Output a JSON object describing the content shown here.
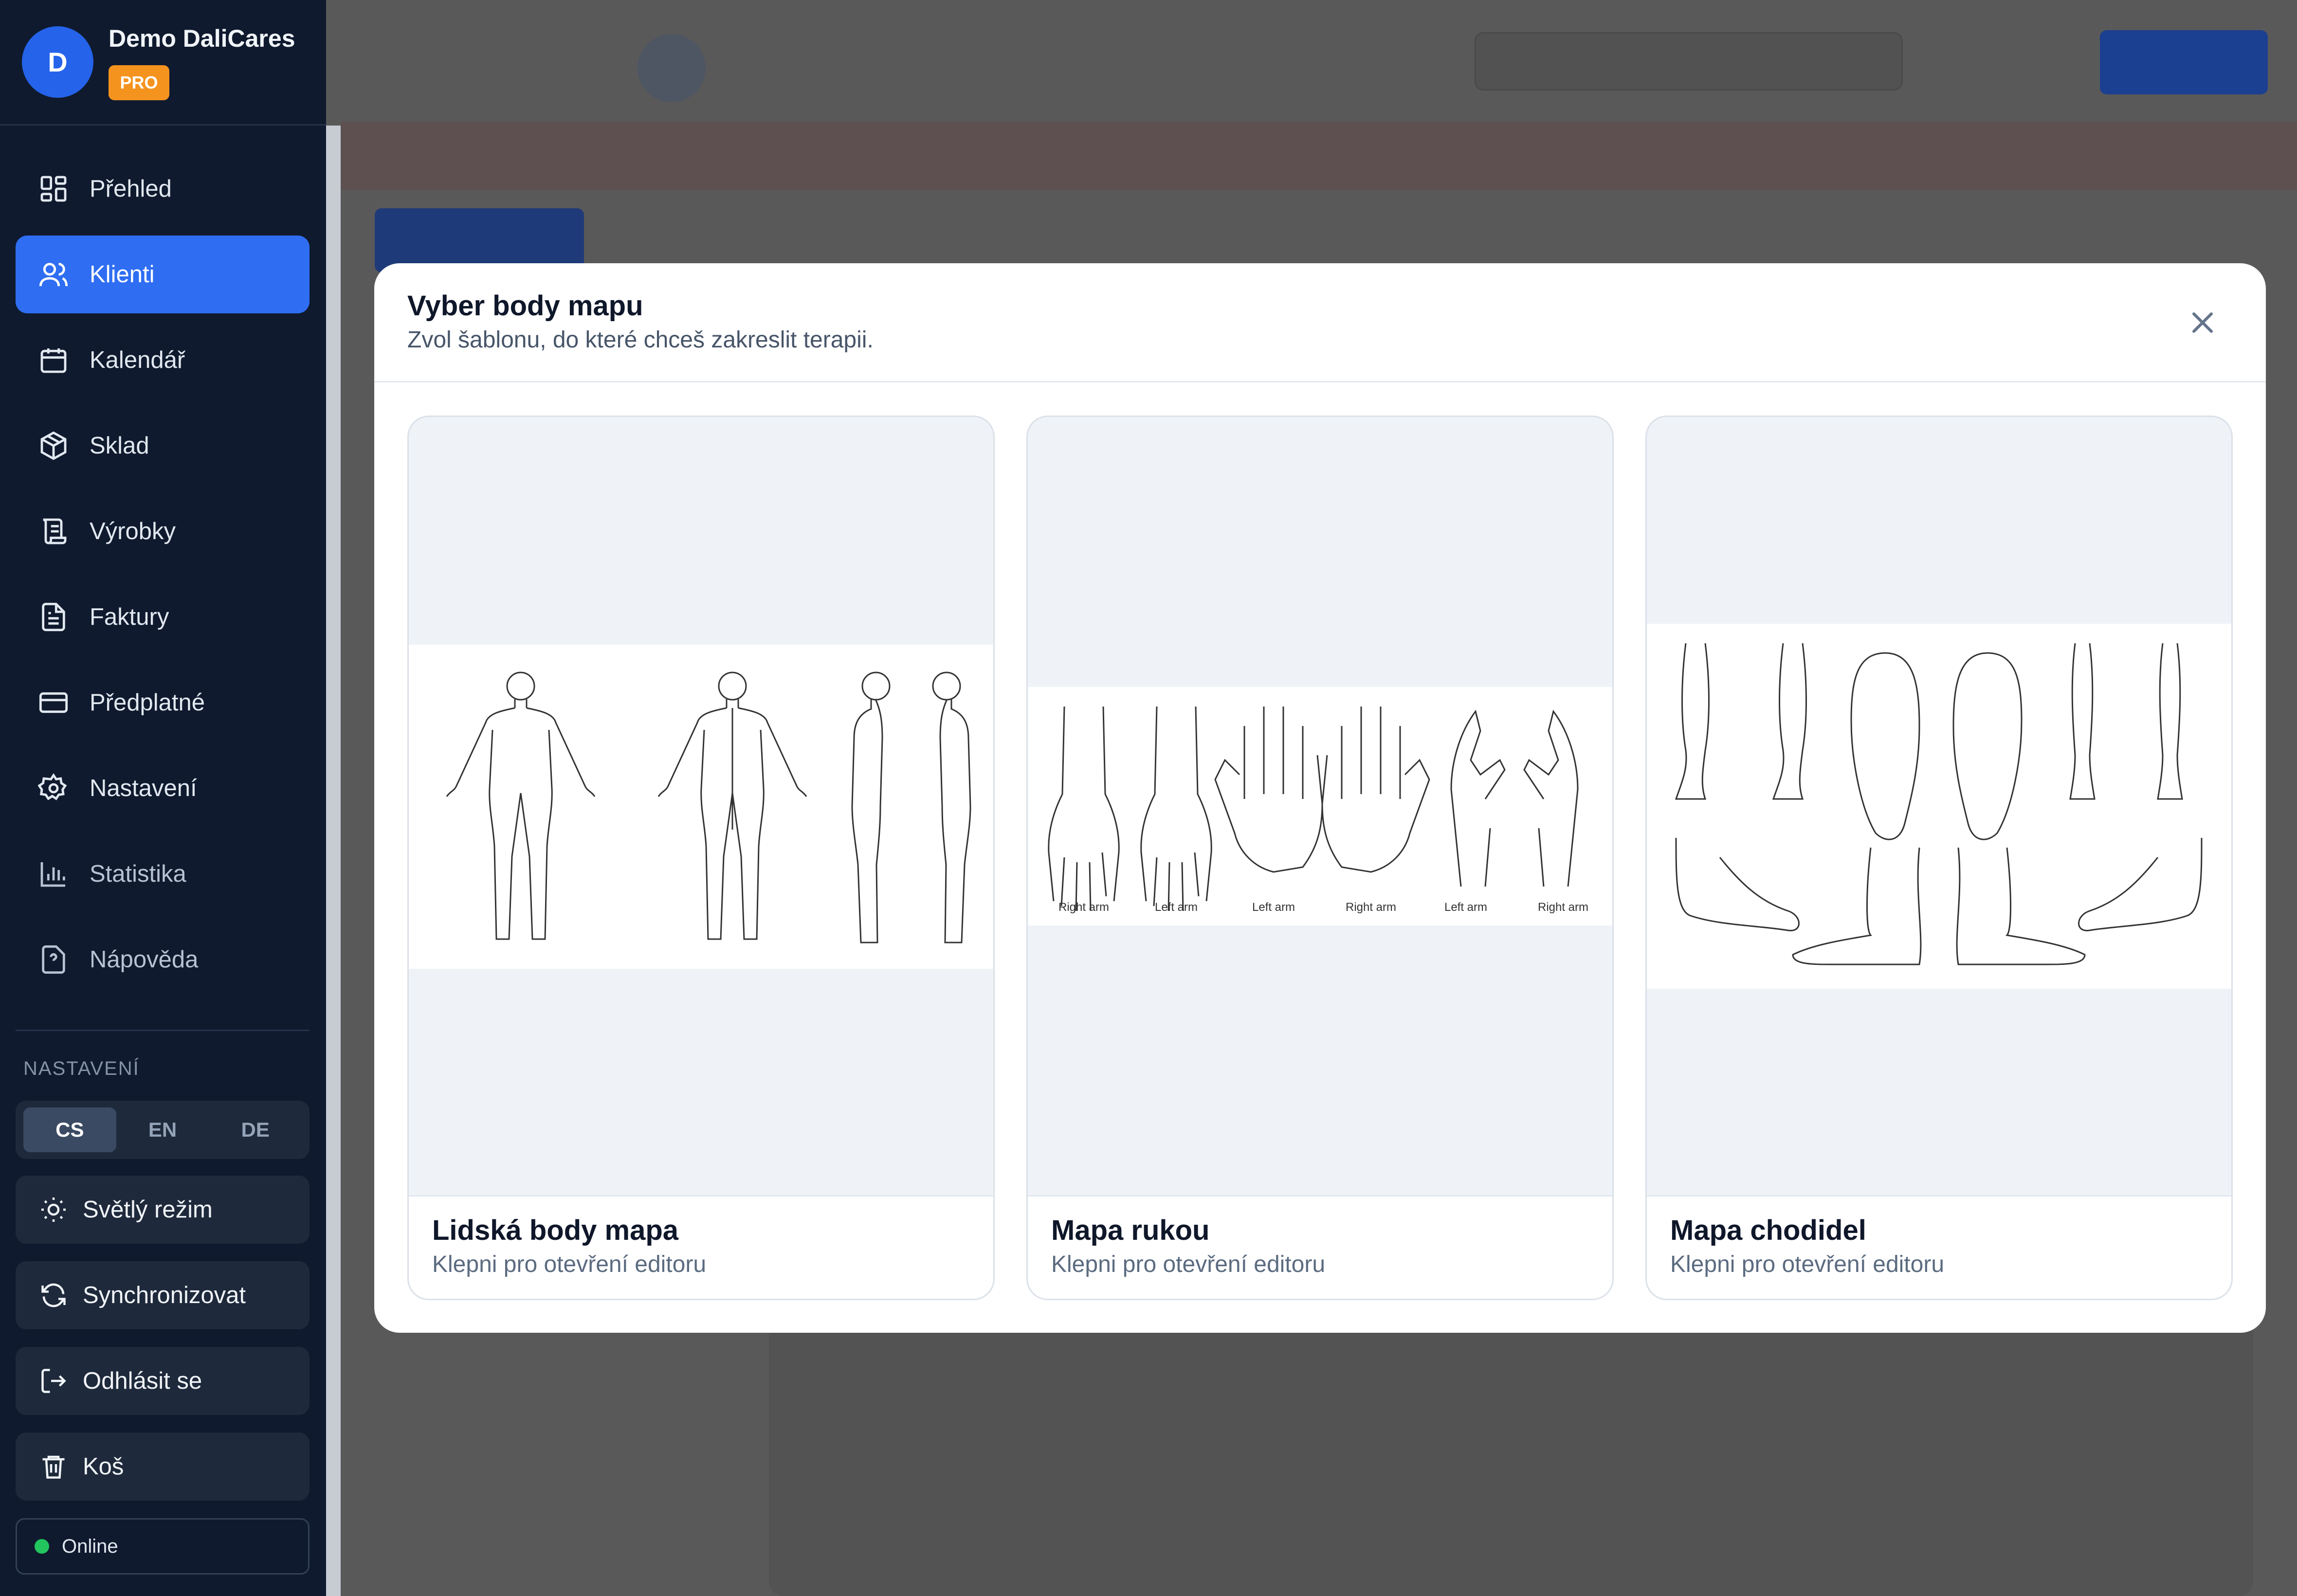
{
  "sidebar": {
    "logo_letter": "D",
    "brand_name": "Demo DaliCares",
    "plan_badge": "PRO",
    "nav": [
      {
        "label": "Přehled",
        "icon": "dashboard-icon"
      },
      {
        "label": "Klienti",
        "icon": "users-icon",
        "active": true
      },
      {
        "label": "Kalendář",
        "icon": "calendar-icon"
      },
      {
        "label": "Sklad",
        "icon": "package-icon"
      },
      {
        "label": "Výrobky",
        "icon": "scroll-icon"
      },
      {
        "label": "Faktury",
        "icon": "file-icon"
      },
      {
        "label": "Předplatné",
        "icon": "credit-card-icon"
      },
      {
        "label": "Nastavení",
        "icon": "gear-icon"
      },
      {
        "label": "Statistika",
        "icon": "bar-chart-icon"
      },
      {
        "label": "Nápověda",
        "icon": "help-icon"
      }
    ],
    "settings_heading": "NASTAVENÍ",
    "languages": [
      "CS",
      "EN",
      "DE"
    ],
    "active_language": "CS",
    "theme_button": "Světlý režim",
    "sync_button": "Synchronizovat",
    "logout_button": "Odhlásit se",
    "trash_button": "Koš",
    "status": "Online"
  },
  "modal": {
    "title": "Vyber body mapu",
    "subtitle": "Zvol šablonu, do které chceš zakreslit terapii.",
    "cards": [
      {
        "title": "Lidská body mapa",
        "subtitle": "Klepni pro otevření editoru"
      },
      {
        "title": "Mapa rukou",
        "subtitle": "Klepni pro otevření editoru",
        "image_labels": [
          "Right arm",
          "Left arm",
          "Left arm",
          "Right arm",
          "Left arm",
          "Right arm"
        ]
      },
      {
        "title": "Mapa chodidel",
        "subtitle": "Klepni pro otevření editoru"
      }
    ]
  },
  "colors": {
    "sidebar_bg": "#0f1a2e",
    "accent": "#2f6ef2",
    "pro_badge": "#f5931f",
    "online": "#22c55e"
  }
}
